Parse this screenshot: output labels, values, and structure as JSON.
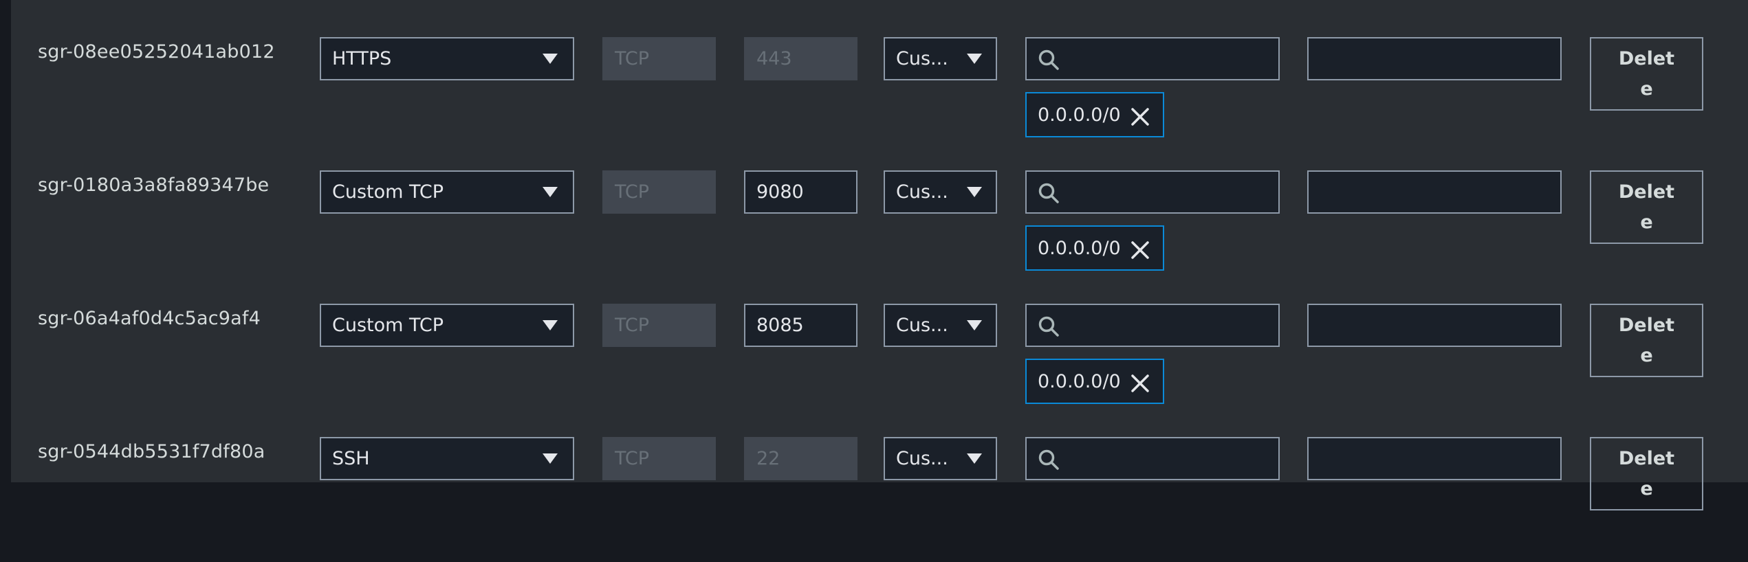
{
  "rules": [
    {
      "id": "sgr-08ee05252041ab012",
      "type": "HTTPS",
      "protocol": "TCP",
      "port": "443",
      "port_editable": false,
      "source": "Cus...",
      "cidr": "0.0.0.0/0",
      "delete_label": "Delete"
    },
    {
      "id": "sgr-0180a3a8fa89347be",
      "type": "Custom TCP",
      "protocol": "TCP",
      "port": "9080",
      "port_editable": true,
      "source": "Cus...",
      "cidr": "0.0.0.0/0",
      "delete_label": "Delete"
    },
    {
      "id": "sgr-06a4af0d4c5ac9af4",
      "type": "Custom TCP",
      "protocol": "TCP",
      "port": "8085",
      "port_editable": true,
      "source": "Cus...",
      "cidr": "0.0.0.0/0",
      "delete_label": "Delete"
    },
    {
      "id": "sgr-0544db5531f7df80a",
      "type": "SSH",
      "protocol": "TCP",
      "port": "22",
      "port_editable": false,
      "source": "Cus...",
      "cidr": "",
      "delete_label": "Delete"
    }
  ],
  "colors": {
    "accent": "#0a8ad8",
    "background": "#2a2e33",
    "field": "#1a2029",
    "disabled": "#414750"
  },
  "icons": {
    "search": "search-icon",
    "remove": "close-icon",
    "dropdown": "caret-down-icon"
  }
}
